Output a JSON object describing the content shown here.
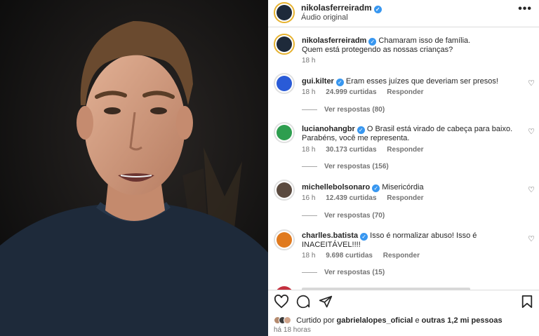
{
  "post": {
    "username": "nikolasferreiradm",
    "audio": "Áudio original",
    "more_icon": "more-horizontal-icon"
  },
  "caption": {
    "username": "nikolasferreiradm",
    "text_line1": "Chamaram isso de família.",
    "text_line2": "Quem está protegendo as nossas crianças?",
    "time": "18 h"
  },
  "comments": [
    {
      "username": "gui.kilter",
      "text": "Eram esses juízes que deveriam ser presos!",
      "time": "18 h",
      "likes": "24.999 curtidas",
      "reply": "Responder",
      "view_replies": "Ver respostas (80)",
      "avatar_color": "#2a5bd7"
    },
    {
      "username": "lucianohangbr",
      "text": "O Brasil está virado de cabeça para baixo. Parabéns, você me representa.",
      "time": "18 h",
      "likes": "30.173 curtidas",
      "reply": "Responder",
      "view_replies": "Ver respostas (156)",
      "avatar_color": "#2e9e4f"
    },
    {
      "username": "michellebolsonaro",
      "text": "Misericórdia",
      "time": "16 h",
      "likes": "12.439 curtidas",
      "reply": "Responder",
      "view_replies": "Ver respostas (70)",
      "avatar_color": "#5b4a3f"
    },
    {
      "username": "charlles.batista",
      "text": "Isso é normalizar abuso! Isso é INACEITÁVEL!!!!",
      "time": "18 h",
      "likes": "9.698 curtidas",
      "reply": "Responder",
      "view_replies": "Ver respostas (15)",
      "avatar_color": "#e07a1f"
    }
  ],
  "liked_by": {
    "prefix": "Curtido por",
    "user": "gabrielalopes_oficial",
    "middle": "e",
    "others": "outras 1,2 mi pessoas"
  },
  "post_time": "há 18 horas",
  "colors": {
    "verified": "#3897f0",
    "story_ring": "#e6b230",
    "shirt": "#1e2a3a"
  }
}
